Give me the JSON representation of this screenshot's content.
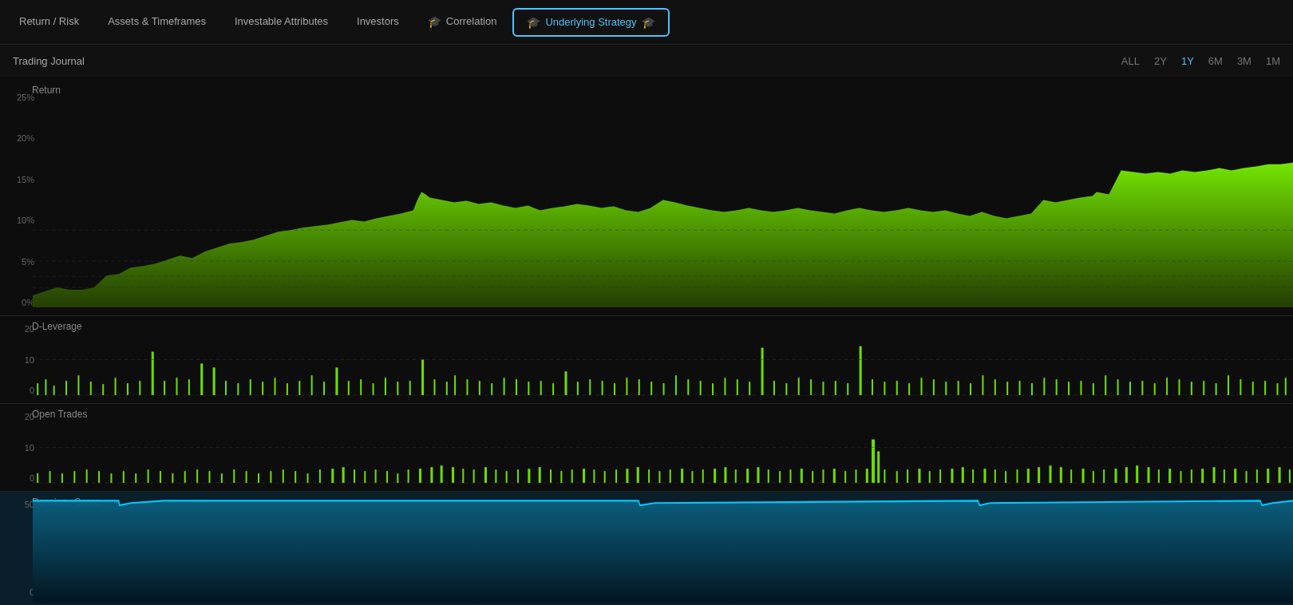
{
  "nav": {
    "tabs": [
      {
        "id": "return-risk",
        "label": "Return / Risk",
        "active": false
      },
      {
        "id": "assets-timeframes",
        "label": "Assets & Timeframes",
        "active": false
      },
      {
        "id": "investable-attributes",
        "label": "Investable Attributes",
        "active": false
      },
      {
        "id": "investors",
        "label": "Investors",
        "active": false
      },
      {
        "id": "correlation",
        "label": "Correlation",
        "active": false
      },
      {
        "id": "underlying-strategy",
        "label": "Underlying Strategy",
        "active": true
      }
    ]
  },
  "sub_header": {
    "title": "Trading Journal",
    "time_filters": [
      "ALL",
      "2Y",
      "1Y",
      "6M",
      "3M",
      "1M"
    ],
    "active_filter": "1Y"
  },
  "return_chart": {
    "label": "Return",
    "y_axis": [
      "25%",
      "20%",
      "15%",
      "10%",
      "5%",
      "0%"
    ]
  },
  "leverage_chart": {
    "label": "D-Leverage",
    "y_axis": [
      "20",
      "10",
      "0"
    ]
  },
  "open_trades_chart": {
    "label": "Open Trades",
    "y_axis": [
      "20",
      "10",
      "0"
    ]
  },
  "darwinex_chart": {
    "label": "Darwinex Score",
    "y_axis": [
      "50",
      "0"
    ]
  },
  "colors": {
    "accent_blue": "#4fc3f7",
    "green_bright": "#7fff00",
    "green_mid": "#5ab300",
    "teal_dark": "#0a3040"
  }
}
